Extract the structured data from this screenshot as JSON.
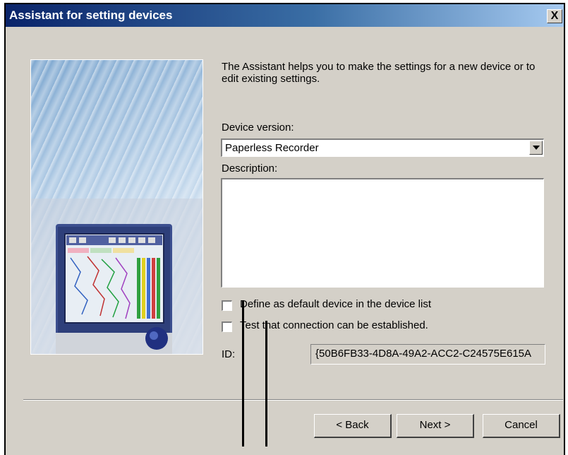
{
  "window": {
    "title": "Assistant for setting devices",
    "close_glyph": "X"
  },
  "intro_text": "The Assistant  helps you to make the settings for a new device or to edit existing settings.",
  "device_version": {
    "label": "Device version:",
    "selected": "Paperless Recorder"
  },
  "description": {
    "label": "Description:",
    "value": ""
  },
  "checkboxes": {
    "default_device": {
      "label": "Define as default device in the device list",
      "checked": false
    },
    "test_connection": {
      "label": "Test that connection can be established.",
      "checked": false
    }
  },
  "id": {
    "label": "ID:",
    "value": "{50B6FB33-4D8A-49A2-ACC2-C24575E615A"
  },
  "buttons": {
    "back": "< Back",
    "next": "Next >",
    "cancel": "Cancel"
  },
  "icons": {
    "close": "close-icon",
    "dropdown": "chevron-down-icon",
    "side_image": "recorder-device-illustration"
  },
  "colors": {
    "title_start": "#0a246a",
    "title_end": "#a6caf0",
    "dialog_bg": "#d4d0c8"
  }
}
